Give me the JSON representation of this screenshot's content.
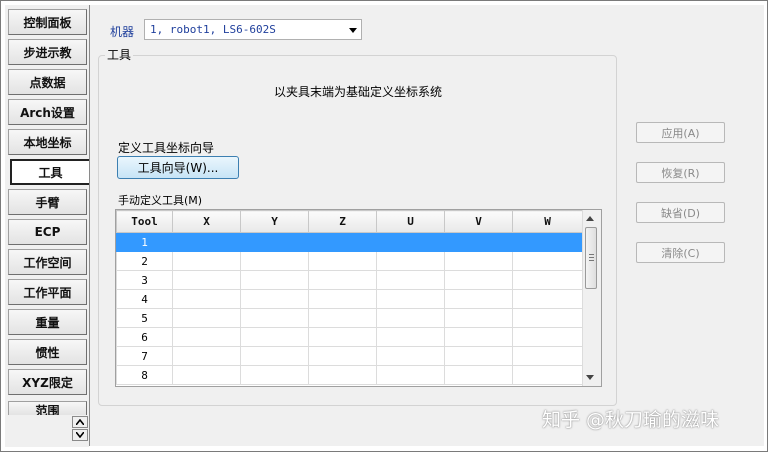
{
  "nav": {
    "items": [
      {
        "label": "控制面板"
      },
      {
        "label": "步进示教"
      },
      {
        "label": "点数据"
      },
      {
        "label": "Arch设置"
      },
      {
        "label": "本地坐标"
      },
      {
        "label": "工具"
      },
      {
        "label": "手臂"
      },
      {
        "label": "ECP"
      },
      {
        "label": "工作空间"
      },
      {
        "label": "工作平面"
      },
      {
        "label": "重量"
      },
      {
        "label": "惯性"
      },
      {
        "label": "XYZ限定"
      },
      {
        "label": "范围"
      }
    ],
    "active": "工具"
  },
  "robot": {
    "label": "机器",
    "selected": "1, robot1, LS6-602S"
  },
  "group": {
    "title": "工具",
    "intro": "以夹具末端为基础定义坐标系统",
    "wizard_label": "定义工具坐标向导",
    "wizard_button": "工具向导(W)...",
    "manual_label": "手动定义工具(M)"
  },
  "table": {
    "columns": [
      "Tool",
      "X",
      "Y",
      "Z",
      "U",
      "V",
      "W"
    ],
    "rows": [
      "1",
      "2",
      "3",
      "4",
      "5",
      "6",
      "7",
      "8"
    ],
    "selected_row": "1"
  },
  "buttons": {
    "apply": "应用(A)",
    "restore": "恢复(R)",
    "default": "缺省(D)",
    "clear": "清除(C)"
  },
  "watermark": "知乎 @秋刀瑜的滋味"
}
